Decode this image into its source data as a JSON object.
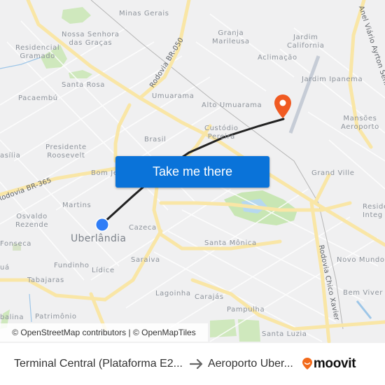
{
  "map": {
    "neighborhoods": [
      {
        "key": "minas_gerais",
        "text": "Minas Gerais"
      },
      {
        "key": "nossa_senhora",
        "text": "Nossa Senhora\ndas Graças"
      },
      {
        "key": "residencial_gramado",
        "text": "Residencial\nGramado"
      },
      {
        "key": "santa_rosa",
        "text": "Santa Rosa"
      },
      {
        "key": "pacaembu",
        "text": "Pacaembú"
      },
      {
        "key": "umuarama",
        "text": "Umuarama"
      },
      {
        "key": "granja_marileusa",
        "text": "Granja\nMarileusa"
      },
      {
        "key": "jardim_california",
        "text": "Jardim\nCalifornia"
      },
      {
        "key": "aclimacao",
        "text": "Aclimação"
      },
      {
        "key": "jardim_ipanema",
        "text": "Jardim Ipanema"
      },
      {
        "key": "alto_umuarama",
        "text": "Alto Umuarama"
      },
      {
        "key": "mansoes_aeroporto",
        "text": "Mansões\nAeroporto"
      },
      {
        "key": "custodio_pereira",
        "text": "Custódio\nPereira"
      },
      {
        "key": "brasil",
        "text": "Brasil"
      },
      {
        "key": "presidente_roosevelt",
        "text": "Presidente\nRoosevelt"
      },
      {
        "key": "brasilia",
        "text": "asília"
      },
      {
        "key": "bom_jesus",
        "text": "Bom Je"
      },
      {
        "key": "grand_ville",
        "text": "Grand Ville"
      },
      {
        "key": "residencial_integracao",
        "text": "Reside\nInteg"
      },
      {
        "key": "martins",
        "text": "Martins"
      },
      {
        "key": "osvaldo_rezende",
        "text": "Osvaldo\nRezende"
      },
      {
        "key": "cazeca",
        "text": "Cazeca"
      },
      {
        "key": "santa_monica",
        "text": "Santa Mônica"
      },
      {
        "key": "novo_mundo",
        "text": "Novo Mundo"
      },
      {
        "key": "fonseca",
        "text": "Fonseca"
      },
      {
        "key": "fundinho",
        "text": "Fundinho"
      },
      {
        "key": "lidice",
        "text": "Lídice"
      },
      {
        "key": "saraiva",
        "text": "Saraiva"
      },
      {
        "key": "tabajaras",
        "text": "Tabajaras"
      },
      {
        "key": "lagoinha",
        "text": "Lagoinha"
      },
      {
        "key": "carajas",
        "text": "Carajás"
      },
      {
        "key": "pampulha",
        "text": "Pampulha"
      },
      {
        "key": "bem_viver",
        "text": "Bem Viver"
      },
      {
        "key": "patrimonio",
        "text": "Patrimônio"
      },
      {
        "key": "bal",
        "text": "balina"
      },
      {
        "key": "ua",
        "text": "uá"
      },
      {
        "key": "santa_luzia",
        "text": "Santa Luzia"
      }
    ],
    "city": "Uberlândia",
    "roads": {
      "br050": "Rodovia BR-050",
      "br365": "Rodovia BR-365",
      "anel": "Anel Viário Ayrton Senna",
      "chico": "Rodovia Chico Xavier"
    },
    "origin_marker": {
      "icon": "origin-dot-icon",
      "color": "#2f7df6"
    },
    "destination_marker": {
      "icon": "destination-pin-icon",
      "color": "#f05a22"
    },
    "route_color": "#222222",
    "cta_label": "Take me there",
    "attribution": "© OpenStreetMap contributors | © OpenMapTiles"
  },
  "footer": {
    "origin": "Terminal Central (Plataforma E2...",
    "arrow_icon": "arrow-right-icon",
    "destination": "Aeroporto Uber...",
    "brand": "moovit",
    "brand_color": "#f26a1b"
  }
}
